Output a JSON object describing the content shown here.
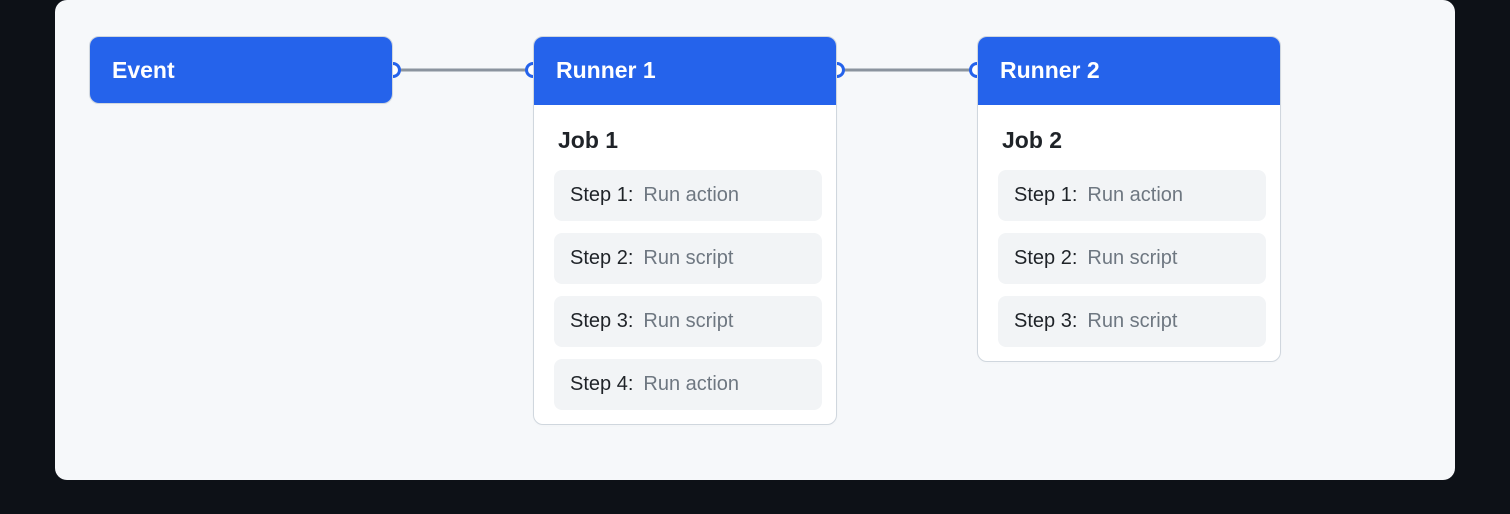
{
  "event": {
    "title": "Event"
  },
  "runners": [
    {
      "title": "Runner 1",
      "job": "Job 1",
      "steps": [
        {
          "label": "Step 1:",
          "desc": "Run action"
        },
        {
          "label": "Step 2:",
          "desc": "Run script"
        },
        {
          "label": "Step 3:",
          "desc": "Run script"
        },
        {
          "label": "Step 4:",
          "desc": "Run action"
        }
      ]
    },
    {
      "title": "Runner 2",
      "job": "Job 2",
      "steps": [
        {
          "label": "Step 1:",
          "desc": "Run action"
        },
        {
          "label": "Step 2:",
          "desc": "Run script"
        },
        {
          "label": "Step 3:",
          "desc": "Run script"
        }
      ]
    }
  ]
}
